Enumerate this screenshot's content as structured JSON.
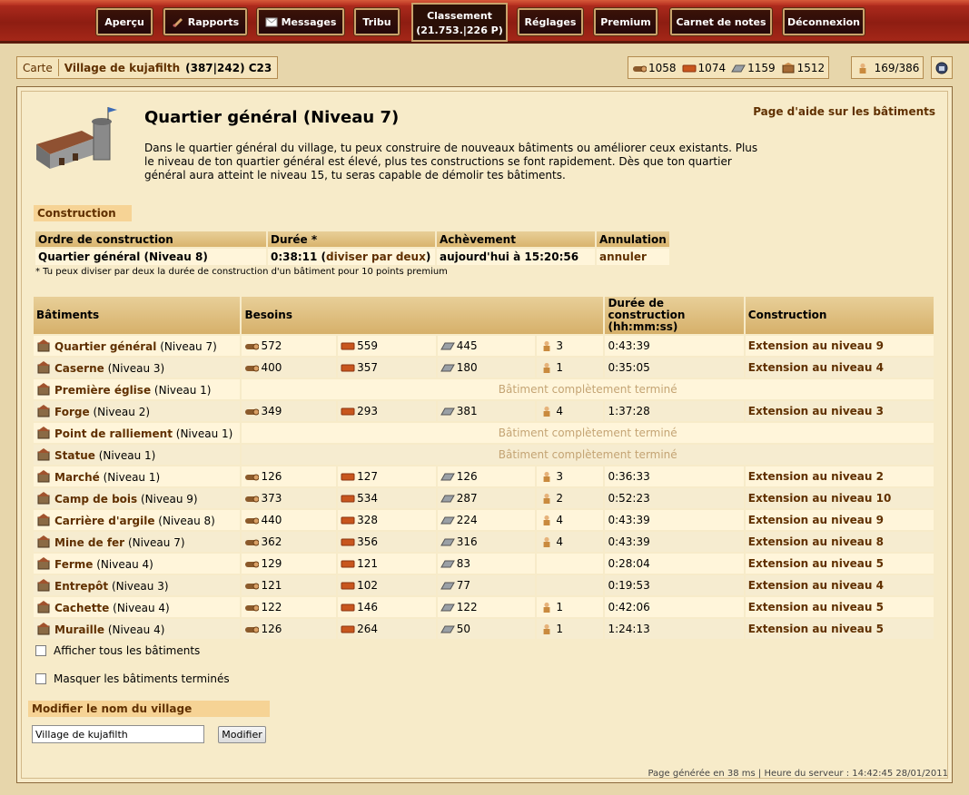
{
  "nav": {
    "items": [
      "Aperçu",
      "Rapports",
      "Messages",
      "Tribu",
      "Réglages",
      "Premium",
      "Carnet de notes",
      "Déconnexion"
    ],
    "ranking_label": "Classement",
    "ranking_value": "(21.753.|226 P)"
  },
  "village": {
    "map_label": "Carte",
    "name": "Village de kujafilth",
    "coords": "(387|242) C23"
  },
  "resources": {
    "wood": "1058",
    "clay": "1074",
    "iron": "1159",
    "storage": "1512",
    "population": "169/386"
  },
  "page": {
    "title": "Quartier général (Niveau 7)",
    "help_link": "Page d'aide sur les bâtiments",
    "description": "Dans le quartier général du village, tu peux construire de nouveaux bâtiments ou améliorer ceux existants. Plus le niveau de ton quartier général est élevé, plus tes constructions se font rapidement. Dès que ton quartier général aura atteint le niveau 15, tu seras capable de démolir tes bâtiments."
  },
  "queue": {
    "section_label": "Construction",
    "headers": [
      "Ordre de construction",
      "Durée *",
      "Achèvement",
      "Annulation"
    ],
    "row": {
      "order": "Quartier général (Niveau 8)",
      "duration": "0:38:11",
      "halve_link": "diviser par deux",
      "completion": "aujourd'hui à 15:20:56",
      "cancel": "annuler"
    },
    "footnote": "* Tu peux diviser par deux la durée de construction d'un bâtiment pour 10 points premium"
  },
  "buildings_table": {
    "headers": {
      "buildings": "Bâtiments",
      "needs": "Besoins",
      "duration": "Durée de construction (hh:mm:ss)",
      "construction": "Construction"
    },
    "complete_text": "Bâtiment complètement terminé",
    "rows": [
      {
        "name": "Quartier général",
        "level": "(Niveau 7)",
        "icon": "headquarters-icon",
        "wood": "572",
        "clay": "559",
        "iron": "445",
        "pop": "3",
        "time": "0:43:39",
        "action": "Extension au niveau 9"
      },
      {
        "name": "Caserne",
        "level": "(Niveau 3)",
        "icon": "barracks-icon",
        "wood": "400",
        "clay": "357",
        "iron": "180",
        "pop": "1",
        "time": "0:35:05",
        "action": "Extension au niveau 4"
      },
      {
        "name": "Première église",
        "level": "(Niveau 1)",
        "icon": "church-icon",
        "complete": true
      },
      {
        "name": "Forge",
        "level": "(Niveau 2)",
        "icon": "smithy-icon",
        "wood": "349",
        "clay": "293",
        "iron": "381",
        "pop": "4",
        "time": "1:37:28",
        "action": "Extension au niveau 3"
      },
      {
        "name": "Point de ralliement",
        "level": "(Niveau 1)",
        "icon": "rally-point-icon",
        "complete": true
      },
      {
        "name": "Statue",
        "level": "(Niveau 1)",
        "icon": "statue-icon",
        "complete": true
      },
      {
        "name": "Marché",
        "level": "(Niveau 1)",
        "icon": "market-icon",
        "wood": "126",
        "clay": "127",
        "iron": "126",
        "pop": "3",
        "time": "0:36:33",
        "action": "Extension au niveau 2"
      },
      {
        "name": "Camp de bois",
        "level": "(Niveau 9)",
        "icon": "timber-camp-icon",
        "wood": "373",
        "clay": "534",
        "iron": "287",
        "pop": "2",
        "time": "0:52:23",
        "action": "Extension au niveau 10"
      },
      {
        "name": "Carrière d'argile",
        "level": "(Niveau 8)",
        "icon": "clay-pit-icon",
        "wood": "440",
        "clay": "328",
        "iron": "224",
        "pop": "4",
        "time": "0:43:39",
        "action": "Extension au niveau 9"
      },
      {
        "name": "Mine de fer",
        "level": "(Niveau 7)",
        "icon": "iron-mine-icon",
        "wood": "362",
        "clay": "356",
        "iron": "316",
        "pop": "4",
        "time": "0:43:39",
        "action": "Extension au niveau 8"
      },
      {
        "name": "Ferme",
        "level": "(Niveau 4)",
        "icon": "farm-icon",
        "wood": "129",
        "clay": "121",
        "iron": "83",
        "pop": "",
        "time": "0:28:04",
        "action": "Extension au niveau 5"
      },
      {
        "name": "Entrepôt",
        "level": "(Niveau 3)",
        "icon": "warehouse-icon",
        "wood": "121",
        "clay": "102",
        "iron": "77",
        "pop": "",
        "time": "0:19:53",
        "action": "Extension au niveau 4"
      },
      {
        "name": "Cachette",
        "level": "(Niveau 4)",
        "icon": "hiding-place-icon",
        "wood": "122",
        "clay": "146",
        "iron": "122",
        "pop": "1",
        "time": "0:42:06",
        "action": "Extension au niveau 5"
      },
      {
        "name": "Muraille",
        "level": "(Niveau 4)",
        "icon": "wall-icon",
        "wood": "126",
        "clay": "264",
        "iron": "50",
        "pop": "1",
        "time": "1:24:13",
        "action": "Extension au niveau 5"
      }
    ]
  },
  "options": {
    "show_all": "Afficher tous les bâtiments",
    "hide_done": "Masquer les bâtiments terminés"
  },
  "rename": {
    "label": "Modifier le nom du village",
    "value": "Village de kujafilth",
    "button": "Modifier"
  },
  "footer": {
    "text": "Page générée en 38 ms | Heure du serveur : 14:42:45 28/01/2011"
  }
}
